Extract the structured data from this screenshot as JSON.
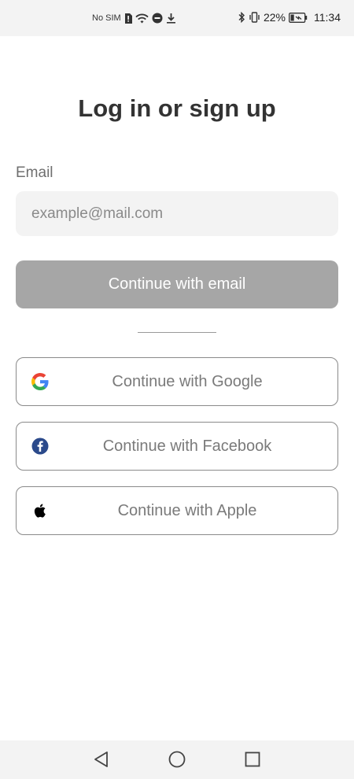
{
  "status_bar": {
    "carrier": "No SIM",
    "battery": "22%",
    "time": "11:34",
    "icons": [
      "sim-alert-icon",
      "wifi-icon",
      "messenger-icon",
      "download-icon",
      "bluetooth-icon",
      "vibrate-icon",
      "battery-icon"
    ]
  },
  "page": {
    "title": "Log in or sign up"
  },
  "email": {
    "label": "Email",
    "placeholder": "example@mail.com",
    "value": "",
    "button_label": "Continue with email"
  },
  "social": {
    "google_label": "Continue with Google",
    "facebook_label": "Continue with Facebook",
    "apple_label": "Continue with Apple"
  },
  "nav": {
    "icons": [
      "back-icon",
      "home-icon",
      "recent-apps-icon"
    ]
  },
  "colors": {
    "title_text": "#333333",
    "disabled_button": "#a6a6a6",
    "input_background": "#f3f3f3",
    "facebook_blue": "#1877f2"
  }
}
